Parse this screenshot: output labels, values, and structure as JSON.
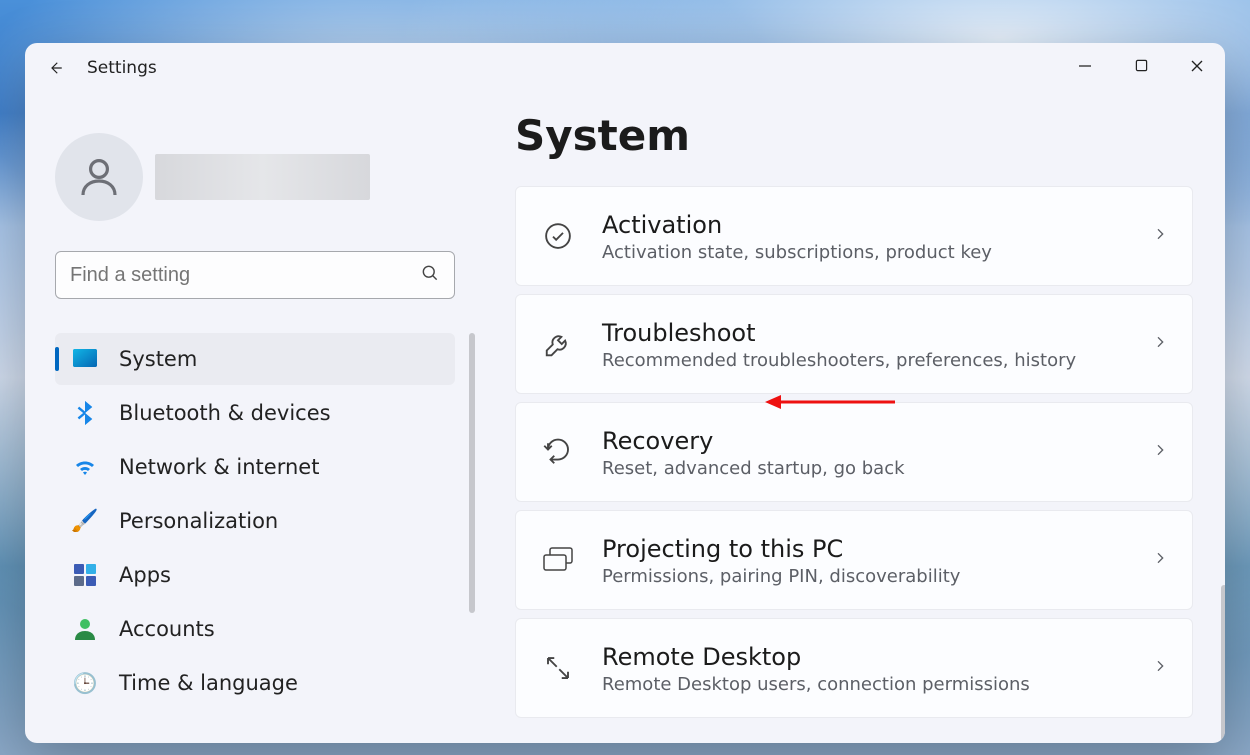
{
  "app_title": "Settings",
  "search_placeholder": "Find a setting",
  "page_heading": "System",
  "sidebar": {
    "items": [
      {
        "label": "System",
        "active": true
      },
      {
        "label": "Bluetooth & devices",
        "active": false
      },
      {
        "label": "Network & internet",
        "active": false
      },
      {
        "label": "Personalization",
        "active": false
      },
      {
        "label": "Apps",
        "active": false
      },
      {
        "label": "Accounts",
        "active": false
      },
      {
        "label": "Time & language",
        "active": false
      }
    ]
  },
  "cards": [
    {
      "title": "Activation",
      "subtitle": "Activation state, subscriptions, product key"
    },
    {
      "title": "Troubleshoot",
      "subtitle": "Recommended troubleshooters, preferences, history"
    },
    {
      "title": "Recovery",
      "subtitle": "Reset, advanced startup, go back"
    },
    {
      "title": "Projecting to this PC",
      "subtitle": "Permissions, pairing PIN, discoverability"
    },
    {
      "title": "Remote Desktop",
      "subtitle": "Remote Desktop users, connection permissions"
    }
  ],
  "annotation": {
    "highlighted_card_index": 1
  }
}
